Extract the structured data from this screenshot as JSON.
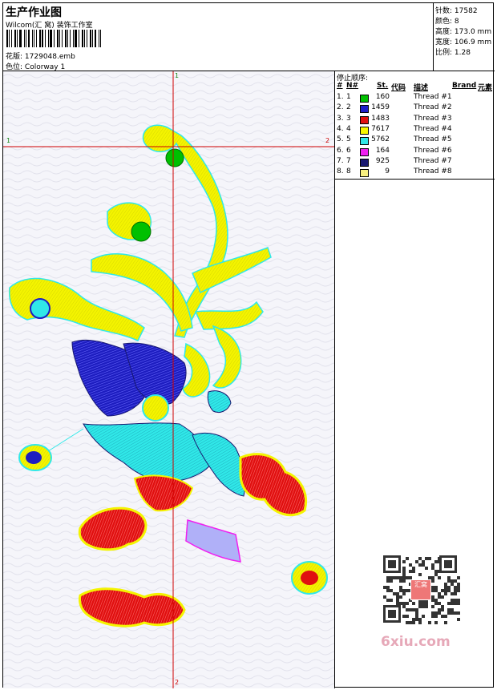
{
  "header": {
    "title": "生产作业图",
    "studio": "Wilcom(汇 窝) 装饰工作室",
    "design_label": "花版:",
    "design_value": "1729048.emb",
    "colorway_label": "色位:",
    "colorway_value": "Colorway 1"
  },
  "stats": [
    {
      "label": "针数:",
      "value": "17582"
    },
    {
      "label": "颜色:",
      "value": "8"
    },
    {
      "label": "高度:",
      "value": "173.0 mm"
    },
    {
      "label": "宽度:",
      "value": "106.9 mm"
    },
    {
      "label": "比例:",
      "value": "1.28"
    }
  ],
  "guides": {
    "h_left": "1",
    "h_right": "2",
    "v_top": "1",
    "v_bottom": "2"
  },
  "stop_sequence": {
    "title": "停止顺序:",
    "headers": {
      "index": "#",
      "needle": "N#",
      "stitches": "St.",
      "code": "代码",
      "desc": "描述",
      "brand": "Brand",
      "element": "元素"
    },
    "rows": [
      {
        "index": "1.",
        "needle": "1",
        "color": "#00c000",
        "stitches": "160",
        "desc": "Thread #1"
      },
      {
        "index": "2.",
        "needle": "2",
        "color": "#1f1fc8",
        "stitches": "1459",
        "desc": "Thread #2"
      },
      {
        "index": "3.",
        "needle": "3",
        "color": "#e01010",
        "stitches": "1483",
        "desc": "Thread #3"
      },
      {
        "index": "4.",
        "needle": "4",
        "color": "#f8f800",
        "stitches": "7617",
        "desc": "Thread #4"
      },
      {
        "index": "5.",
        "needle": "5",
        "color": "#30e8e8",
        "stitches": "5762",
        "desc": "Thread #5"
      },
      {
        "index": "6.",
        "needle": "6",
        "color": "#f020f0",
        "stitches": "164",
        "desc": "Thread #6"
      },
      {
        "index": "7.",
        "needle": "7",
        "color": "#181870",
        "stitches": "925",
        "desc": "Thread #7"
      },
      {
        "index": "8.",
        "needle": "8",
        "color": "#f8f080",
        "stitches": "9",
        "desc": "Thread #8"
      }
    ]
  },
  "watermark": "6xiu.com",
  "qr_badge": "汇窝"
}
